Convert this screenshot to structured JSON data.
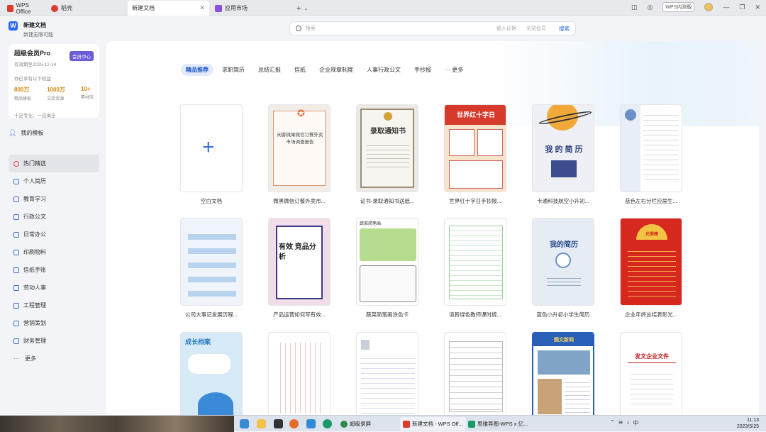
{
  "tabs": [
    {
      "label": "WPS Office",
      "color": "#e03a2c"
    },
    {
      "label": "稻壳",
      "color": "#e03a2c"
    },
    {
      "label": "新建文档",
      "color": "#2a6af0"
    },
    {
      "label": "应用市场",
      "color": "#8a4ee0"
    }
  ],
  "window": {
    "beta_badge": "WPS内测版"
  },
  "header": {
    "title": "新建文档",
    "subtitle": "新建无限可能"
  },
  "vip": {
    "name": "超级会员Pro",
    "expire": "有效期至2025-12-14",
    "center_button": "会员中心",
    "perks_label": "你已享有以下权益",
    "stats": [
      {
        "value": "800万",
        "label": "精品模板"
      },
      {
        "value": "1000万",
        "label": "文库资源"
      },
      {
        "value": "10+",
        "label": "素材库"
      }
    ],
    "slogan": "十足专业，一应俱全"
  },
  "my_templates": "我的模板",
  "nav": [
    {
      "label": "热门精选",
      "icon": "fire-icon"
    },
    {
      "label": "个人简历",
      "icon": "resume-icon"
    },
    {
      "label": "教育学习",
      "icon": "education-icon"
    },
    {
      "label": "行政公文",
      "icon": "document-icon"
    },
    {
      "label": "日常办公",
      "icon": "office-icon"
    },
    {
      "label": "印刷物料",
      "icon": "print-icon"
    },
    {
      "label": "信纸手账",
      "icon": "letter-icon"
    },
    {
      "label": "劳动人事",
      "icon": "people-icon"
    },
    {
      "label": "工程管理",
      "icon": "engineering-icon"
    },
    {
      "label": "营销策划",
      "icon": "marketing-icon"
    },
    {
      "label": "财务管理",
      "icon": "finance-icon"
    },
    {
      "label": "更多",
      "icon": "more-icon"
    }
  ],
  "search": {
    "placeholder": "搜索",
    "opt1": "嵌入证据",
    "opt2": "全站会员",
    "button": "搜索"
  },
  "categories": [
    "精品推荐",
    "求职简历",
    "总结汇报",
    "信纸",
    "企业规章制度",
    "人事行政公文",
    "手抄报",
    "··· 更多"
  ],
  "templates_row1": [
    "空白文档",
    "微黑微信订餐外卖市...",
    "证书-录取通知书送纸...",
    "世界红十字日手抄报...",
    "卡通科技航空小升初...",
    "蓝色左右分栏应届生..."
  ],
  "templates_row2": [
    "公司大事记发展历程...",
    "产品运营如何写有效...",
    "蔬菜简笔画涂色卡",
    "清新绿色教师课时统...",
    "蓝色小升初小学生简历",
    "企业年终总结表彰光..."
  ],
  "thumbs": {
    "survey_title": "闲客微果微信订餐外卖市场调查报告",
    "notice": "录取通知书",
    "redcross": "世界红十字日",
    "resume": "我 的 简 历",
    "resume2": "我的简历",
    "product": "有效 竞品分析",
    "vegetable": "蔬菜简笔画",
    "honor": "光荣榜",
    "growth": "成长档案",
    "doc": "发文企业文件",
    "news": "图文新闻"
  },
  "taskbar": {
    "apps": [
      "超级录屏",
      "新建文档 - WPS Off...",
      "思维导图-WPS x 亿..."
    ],
    "time": "11:13",
    "date": "2023/5/25",
    "ime": "中"
  }
}
